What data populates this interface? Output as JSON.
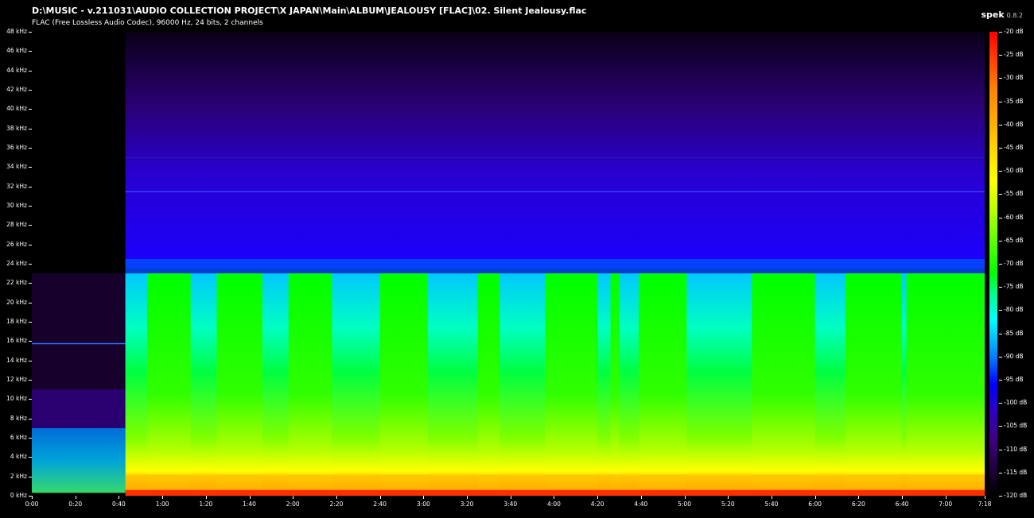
{
  "window": {
    "title": "D:\\MUSIC - v.211031\\AUDIO COLLECTION PROJECT\\X JAPAN\\Main\\ALBUM\\JEALOUSY [FLAC]\\02. Silent Jealousy.flac",
    "subtitle": "FLAC (Free Lossless Audio Codec), 96000 Hz, 24 bits, 2 channels",
    "app_name": "spek",
    "app_version": "0.8.2"
  },
  "colors": {
    "background": "#000000",
    "text": "#ffffff"
  },
  "spectrogram": {
    "freq_ticks": [
      "48 kHz",
      "46 kHz",
      "44 kHz",
      "42 kHz",
      "40 kHz",
      "38 kHz",
      "36 kHz",
      "34 kHz",
      "32 kHz",
      "30 kHz",
      "28 kHz",
      "26 kHz",
      "24 kHz",
      "22 kHz",
      "20 kHz",
      "18 kHz",
      "16 kHz",
      "14 kHz",
      "12 kHz",
      "10 kHz",
      "8 kHz",
      "6 kHz",
      "4 kHz",
      "2 kHz",
      "0 kHz"
    ],
    "time_ticks": [
      "0:00",
      "0:20",
      "0:40",
      "1:00",
      "1:20",
      "1:40",
      "2:00",
      "2:20",
      "2:40",
      "3:00",
      "3:20",
      "3:40",
      "4:00",
      "4:20",
      "4:40",
      "5:00",
      "5:20",
      "5:40",
      "6:00",
      "6:20",
      "6:40",
      "7:00",
      "7:18"
    ],
    "db_ticks": [
      "-20 dB",
      "-25 dB",
      "-30 dB",
      "-35 dB",
      "-40 dB",
      "-45 dB",
      "-50 dB",
      "-55 dB",
      "-60 dB",
      "-65 dB",
      "-70 dB",
      "-75 dB",
      "-80 dB",
      "-85 dB",
      "-90 dB",
      "-95 dB",
      "-100 dB",
      "-105 dB",
      "-110 dB",
      "-115 dB",
      "-120 dB"
    ]
  }
}
